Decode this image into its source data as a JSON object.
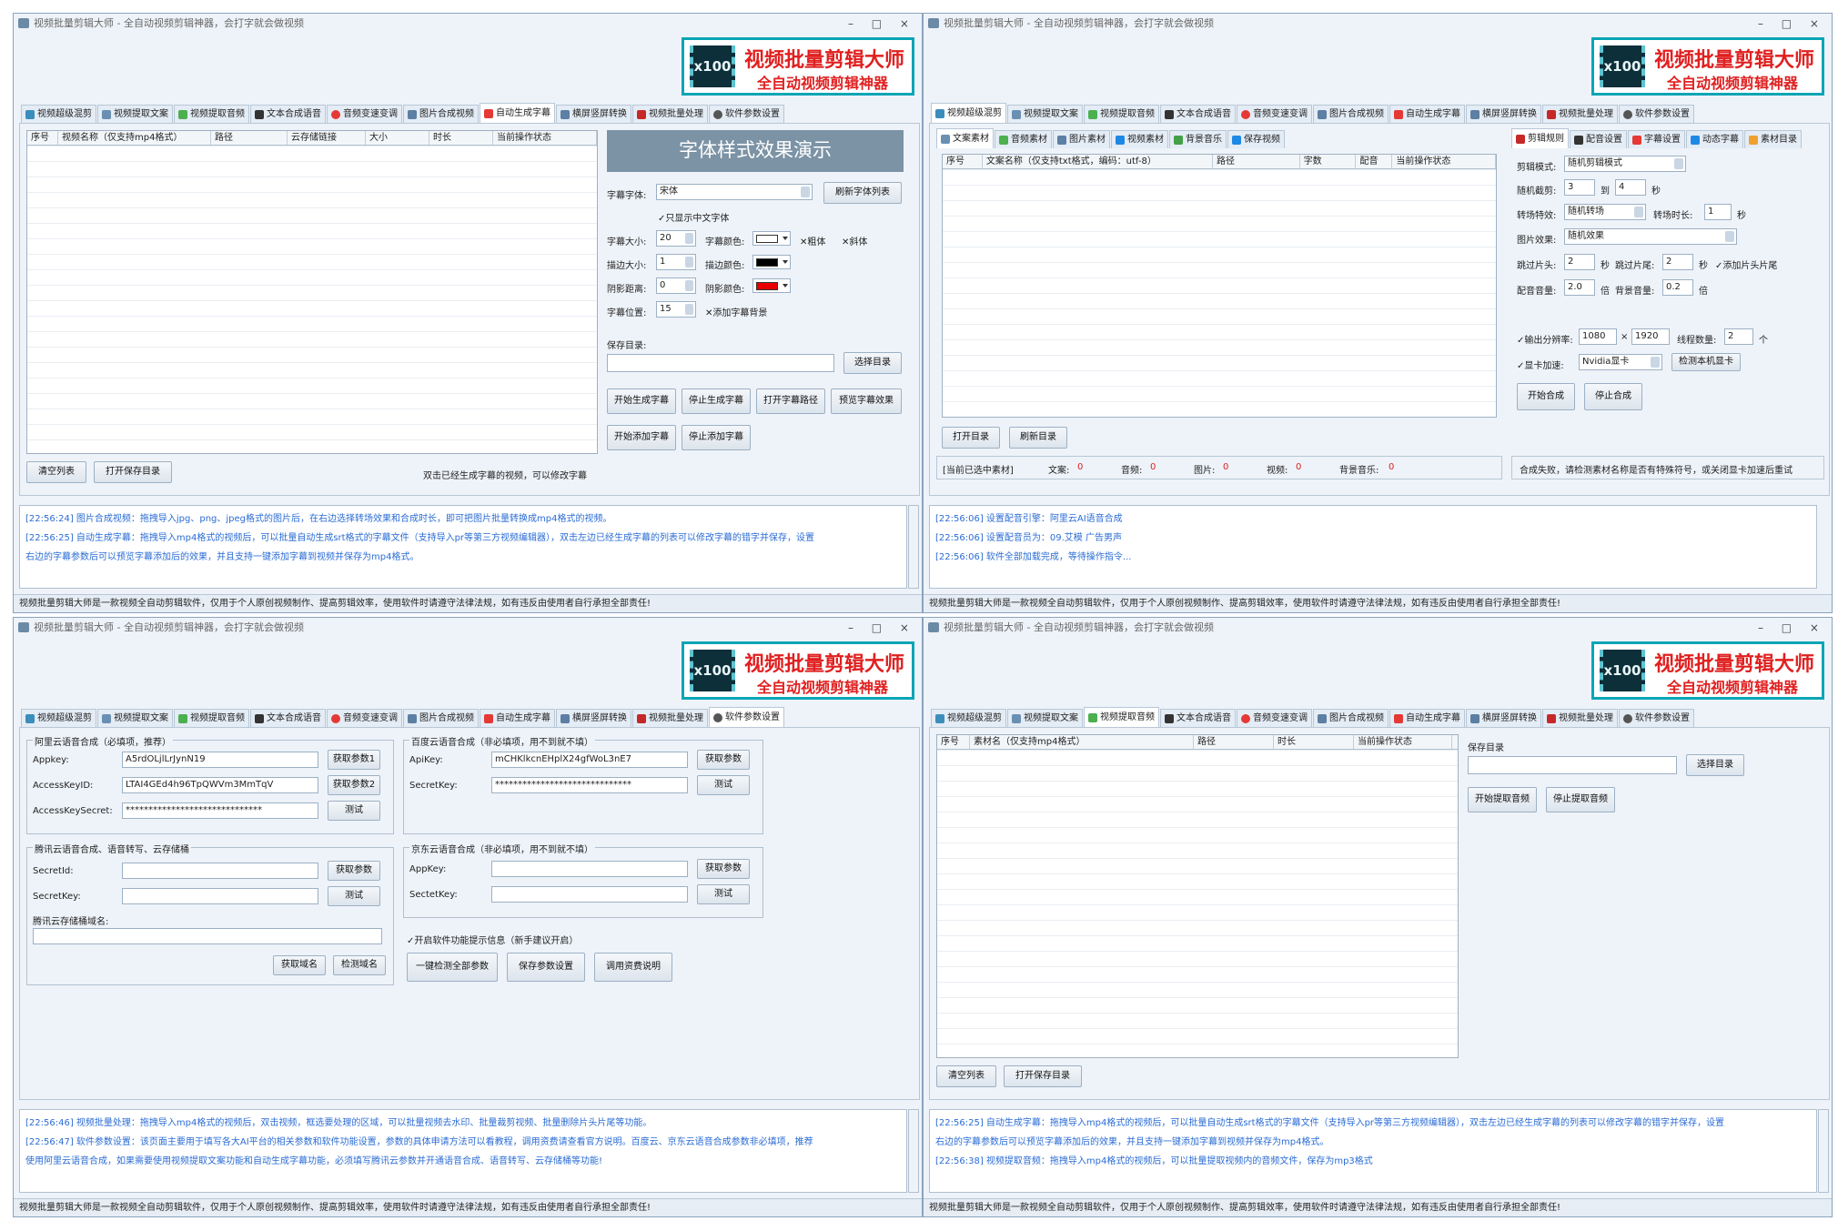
{
  "app": {
    "window_title": "视频批量剪辑大师 - 全自动视频剪辑神器，会打字就会做视频",
    "window_buttons": "– □ ×",
    "logo_badge": "x100",
    "logo_line1": "视频批量剪辑大师",
    "logo_line2": "全自动视频剪辑神器",
    "status_text": "视频批量剪辑大师是一款视频全自动剪辑软件，仅用于个人原创视频制作、提高剪辑效率，使用软件时请遵守法律法规，如有违反由使用者自行承担全部责任!",
    "tabs": [
      "视频超级混剪",
      "视频提取文案",
      "视频提取音频",
      "文本合成语音",
      "音频变速变调",
      "图片合成视频",
      "自动生成字幕",
      "横屏竖屏转换",
      "视频批量处理",
      "软件参数设置"
    ]
  },
  "colors": {
    "accent": "#0aa5b4",
    "brand_red": "#e02020",
    "log_blue": "#2b6cd4",
    "window_bg": "#eef3f9"
  },
  "subtitle_window": {
    "grid_headers": [
      "序号",
      "视频名称（仅支持mp4格式）",
      "路径",
      "云存储链接",
      "大小",
      "时长",
      "当前操作状态"
    ],
    "demo_title": "字体样式效果演示",
    "font_label": "字幕字体:",
    "font_value": "宋体",
    "refresh_fonts": "刷新字体列表",
    "only_chinese": "✓只显示中文字体",
    "size_label": "字幕大小:",
    "size_value": "20",
    "color_label": "字幕颜色:",
    "bold": "✕粗体",
    "italic": "✕斜体",
    "stroke_label": "描边大小:",
    "stroke_value": "1",
    "stroke_color_label": "描边颜色:",
    "shadow_label": "阴影距离:",
    "shadow_value": "0",
    "shadow_color_label": "阴影颜色:",
    "pos_label": "字幕位置:",
    "pos_value": "15",
    "add_bg": "✕添加字幕背景",
    "save_dir_label": "保存目录:",
    "choose_dir": "选择目录",
    "btn_start_gen": "开始生成字幕",
    "btn_stop_gen": "停止生成字幕",
    "btn_open_path": "打开字幕路径",
    "btn_preview": "预览字幕效果",
    "btn_start_add": "开始添加字幕",
    "btn_stop_add": "停止添加字幕",
    "btn_clear": "清空列表",
    "btn_open_save": "打开保存目录",
    "hint": "双击已经生成字幕的视频，可以修改字幕",
    "log": [
      "[22:56:24] 图片合成视频：拖拽导入jpg、png、jpeg格式的图片后，在右边选择转场效果和合成时长，即可把图片批量转换成mp4格式的视频。",
      "[22:56:25] 自动生成字幕：拖拽导入mp4格式的视频后，可以批量自动生成srt格式的字幕文件（支持导入pr等第三方视频编辑器），双击左边已经生成字幕的列表可以修改字幕的错字并保存，设置",
      "右边的字幕参数后可以预览字幕添加后的效果，并且支持一键添加字幕到视频并保存为mp4格式。"
    ]
  },
  "mix_window": {
    "subtabs": [
      "文案素材",
      "音频素材",
      "图片素材",
      "视频素材",
      "背景音乐",
      "保存视频"
    ],
    "grid_headers": [
      "序号",
      "文案名称（仅支持txt格式，编码：utf-8）",
      "路径",
      "字数",
      "配音",
      "当前操作状态"
    ],
    "btn_open_dir": "打开目录",
    "btn_refresh_dir": "刷新目录",
    "summary_label": "[当前已选中素材]",
    "summary": [
      {
        "k": "文案:",
        "v": "0"
      },
      {
        "k": "音频:",
        "v": "0"
      },
      {
        "k": "图片:",
        "v": "0"
      },
      {
        "k": "视频:",
        "v": "0"
      },
      {
        "k": "背景音乐:",
        "v": "0"
      }
    ],
    "rtabs": [
      "剪辑规则",
      "配音设置",
      "字幕设置",
      "动态字幕",
      "素材目录"
    ],
    "mode_label": "剪辑模式:",
    "mode_value": "随机剪辑模式",
    "crop_label": "随机截剪:",
    "crop_from": "3",
    "crop_to_word": "到",
    "crop_to": "4",
    "sec": "秒",
    "trans_label": "转场特效:",
    "trans_value": "随机转场",
    "trans_dur_label": "转场时长:",
    "trans_dur": "1",
    "img_effect_label": "图片效果:",
    "img_effect_value": "随机效果",
    "skip_head_label": "跳过片头:",
    "skip_head": "2",
    "skip_tail_label": "跳过片尾:",
    "skip_tail": "2",
    "add_head_tail": "✓添加片头片尾",
    "dub_vol_label": "配音音量:",
    "dub_vol": "2.0",
    "times": "倍",
    "bgm_vol_label": "背景音量:",
    "bgm_vol": "0.2",
    "res_label": "✓输出分辨率:",
    "res_w": "1080",
    "res_x": "×",
    "res_h": "1920",
    "threads_label": "线程数量:",
    "threads": "2",
    "unit_ge": "个",
    "gpu_label": "✓显卡加速:",
    "gpu_value": "Nvidia显卡",
    "gpu_detect": "检测本机显卡",
    "btn_start": "开始合成",
    "btn_stop": "停止合成",
    "fail_msg": "合成失败，请检测素材名称是否有特殊符号，或关闭显卡加速后重试",
    "log": [
      "[22:56:06] 设置配音引擎：阿里云AI语音合成",
      "[22:56:06] 设置配音员为：09.艾模 广告男声",
      "[22:56:06] 软件全部加载完成，等待操作指令..."
    ]
  },
  "settings_window": {
    "aliyun_title": "阿里云语音合成（必填项，推荐）",
    "appkey_label": "Appkey:",
    "appkey_value": "A5rdOLjlLrJynN19",
    "get_param1": "获取参数1",
    "akid_label": "AccessKeyID:",
    "akid_value": "LTAI4GEd4h96TpQWVm3MmTqV",
    "get_param2": "获取参数2",
    "aksecret_label": "AccessKeySecret:",
    "aksecret_value": "******************************",
    "test": "测试",
    "baidu_title": "百度云语音合成（非必填项，用不到就不填）",
    "apikey_label": "ApiKey:",
    "apikey_value": "mCHKlkcnEHplX24gfWoL3nE7",
    "get_param": "获取参数",
    "secretkey_label": "SecretKey:",
    "secretkey_value": "******************************",
    "tencent_title": "腾讯云语音合成、语音转写、云存储桶",
    "secretid_label": "SecretId:",
    "tsecretkey_label": "SecretKey:",
    "bucket_label": "腾讯云存储桶域名:",
    "get_domain": "获取域名",
    "check_domain": "检测域名",
    "jd_title": "京东云语音合成（非必填项，用不到就不填）",
    "jd_appkey_label": "AppKey:",
    "jd_secretkey_label": "SectetKey:",
    "show_tips": "✓开启软件功能提示信息（新手建议开启）",
    "btn_check_all": "一键检测全部参数",
    "btn_save_params": "保存参数设置",
    "btn_usage": "调用资费说明",
    "log": [
      "[22:56:46] 视频批量处理：拖拽导入mp4格式的视频后，双击视频，框选要处理的区域，可以批量视频去水印、批量裁剪视频、批量删除片头片尾等功能。",
      "[22:56:47] 软件参数设置：该页面主要用于填写各大AI平台的相关参数和软件功能设置，参数的具体申请方法可以看教程，调用资费请查看官方说明。百度云、京东云语音合成参数非必填项，推荐",
      "使用阿里云语音合成，如果需要使用视频提取文案功能和自动生成字幕功能，必须填写腾讯云参数并开通语音合成、语音转写、云存储桶等功能!"
    ]
  },
  "audio_window": {
    "grid_headers": [
      "序号",
      "素材名（仅支持mp4格式）",
      "路径",
      "时长",
      "当前操作状态"
    ],
    "save_dir_label": "保存目录",
    "choose_dir": "选择目录",
    "btn_start": "开始提取音频",
    "btn_stop": "停止提取音频",
    "btn_clear": "清空列表",
    "btn_open_save": "打开保存目录",
    "log": [
      "[22:56:25] 自动生成字幕：拖拽导入mp4格式的视频后，可以批量自动生成srt格式的字幕文件（支持导入pr等第三方视频编辑器），双击左边已经生成字幕的列表可以修改字幕的错字并保存，设置",
      "右边的字幕参数后可以预览字幕添加后的效果，并且支持一键添加字幕到视频并保存为mp4格式。",
      "[22:56:38] 视频提取音频：拖拽导入mp4格式的视频后，可以批量提取视频内的音频文件，保存为mp3格式"
    ]
  }
}
